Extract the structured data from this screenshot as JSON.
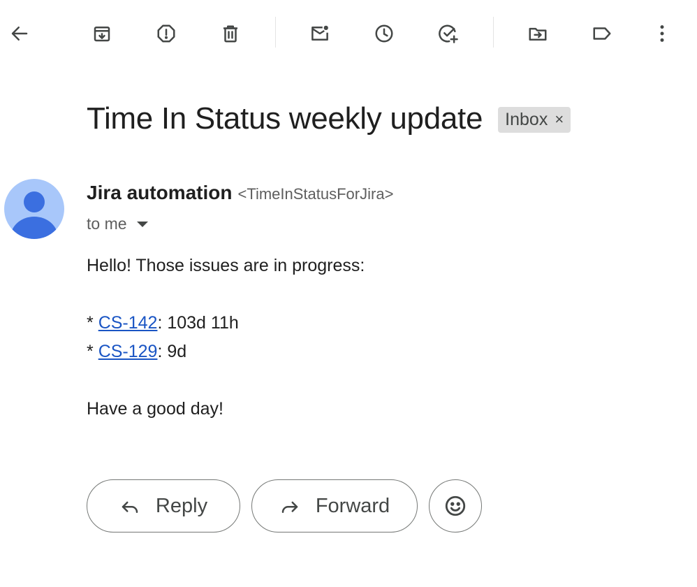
{
  "toolbar": {
    "icons": [
      "back-arrow-icon",
      "archive-icon",
      "report-spam-icon",
      "delete-icon",
      "mark-unread-icon",
      "snooze-icon",
      "add-task-icon",
      "move-to-icon",
      "label-icon",
      "more-icon"
    ]
  },
  "email": {
    "subject": "Time In Status weekly update",
    "label_chip": "Inbox",
    "label_close": "×",
    "sender_name": "Jira automation",
    "sender_email": "<TimeInStatusForJira>",
    "recipient_text": "to me",
    "body": {
      "greeting": "Hello! Those issues are in progress:",
      "issues": [
        {
          "bullet": "*",
          "key": "CS-142",
          "duration": ": 103d 11h"
        },
        {
          "bullet": "*",
          "key": "CS-129",
          "duration": ": 9d"
        }
      ],
      "closing": "Have a good day!"
    }
  },
  "actions": {
    "reply_label": "Reply",
    "forward_label": "Forward"
  },
  "colors": {
    "link": "#1a55c4",
    "avatar_bg": "#a8c7fa",
    "avatar_fg": "#3b6fe0",
    "chip_bg": "#dddddd"
  }
}
